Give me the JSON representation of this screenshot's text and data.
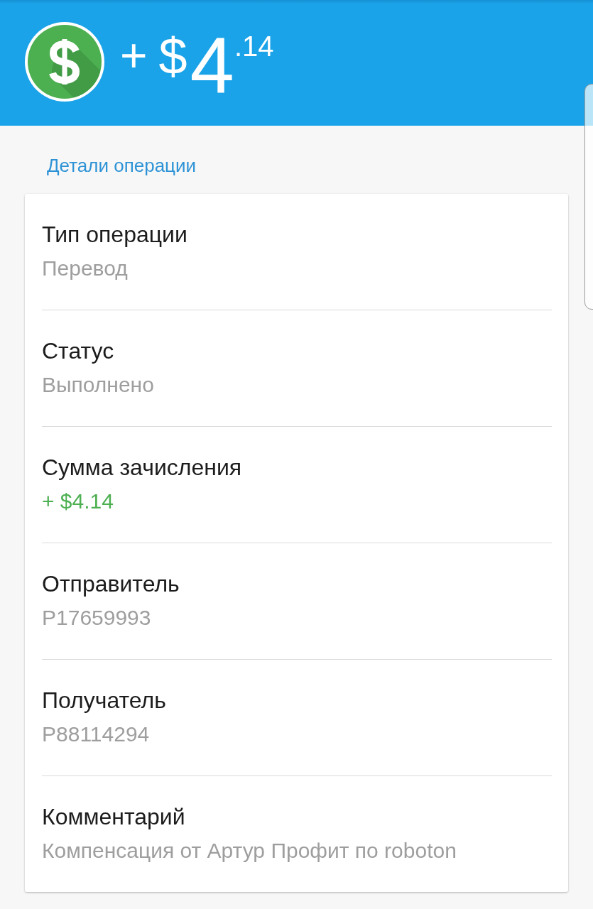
{
  "header": {
    "sign": "+",
    "currency": "$",
    "amount_whole": "4",
    "amount_fraction": ".14"
  },
  "section_title": "Детали операции",
  "details": [
    {
      "kind": "plain",
      "label": "Тип операции",
      "value": "Перевод"
    },
    {
      "kind": "plain",
      "label": "Статус",
      "value": "Выполнено"
    },
    {
      "kind": "credit",
      "label": "Сумма зачисления",
      "value": "+ $4.14"
    },
    {
      "kind": "plain",
      "label": "Отправитель",
      "value": "P17659993"
    },
    {
      "kind": "plain",
      "label": "Получатель",
      "value": "P88114294"
    },
    {
      "kind": "plain",
      "label": "Комментарий",
      "value": "Компенсация от Артур Профит по roboton"
    }
  ]
}
